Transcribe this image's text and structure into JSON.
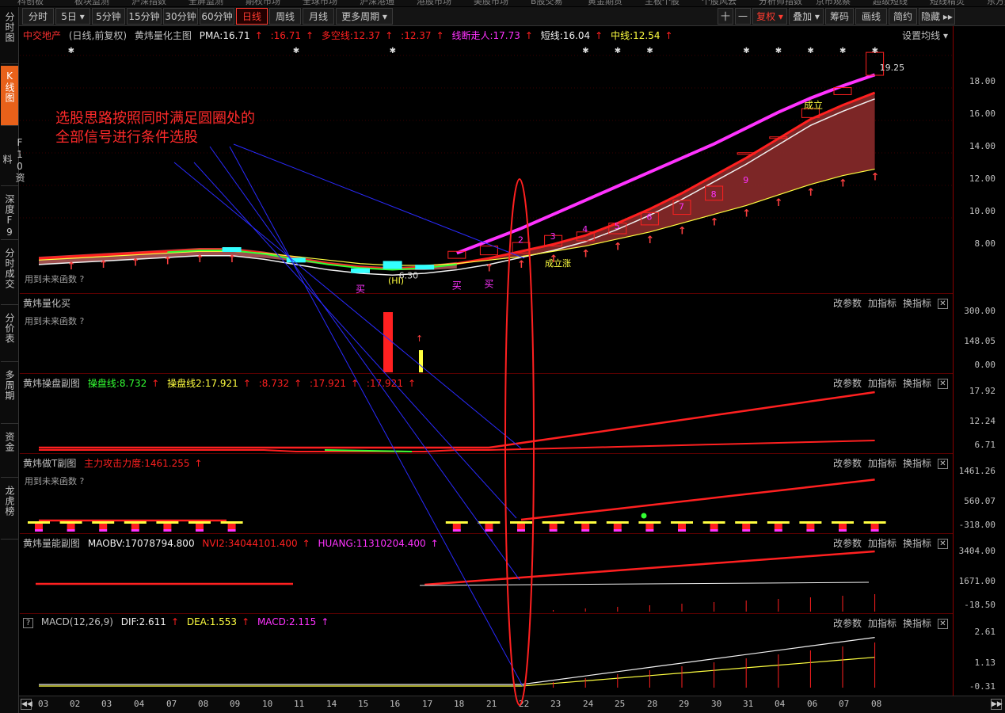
{
  "colors": {
    "red": "#ff2020",
    "magenta": "#ff33ff",
    "yellow": "#ffff40",
    "green": "#33ff33",
    "cyan": "#33ffff",
    "white": "#f0f0f0",
    "orange_tab": "#e8611a",
    "blue_line": "#2a2aff"
  },
  "top_strip": [
    "科创板",
    "板块监测",
    "沪深指数",
    "全屏监测",
    "期权市场",
    "全球市场",
    "沪深港通",
    "港股市场",
    "美股市场",
    "B股交易",
    "黄金期货",
    "主板个股",
    "个股风云",
    "分析师指数",
    "京市观察",
    "超级短线",
    "短线精灵",
    "东方财富"
  ],
  "toolbar": {
    "periods": [
      "分时",
      "5日",
      "5分钟",
      "15分钟",
      "30分钟",
      "60分钟",
      "日线",
      "周线",
      "月线",
      "更多周期"
    ],
    "active_period": "日线",
    "right_tools": [
      "十",
      "一",
      "复权",
      "叠加",
      "筹码",
      "画线",
      "简约",
      "隐藏"
    ]
  },
  "sidebar": [
    {
      "label": "分时图",
      "icon": ""
    },
    {
      "label": "K线图",
      "icon": ""
    },
    {
      "label": "F10资料",
      "icon": ""
    },
    {
      "label": "深度F9",
      "icon": ""
    },
    {
      "label": "分时成交",
      "icon": ""
    },
    {
      "label": "分价表",
      "icon": ""
    },
    {
      "label": "多周期",
      "icon": ""
    },
    {
      "label": "资金",
      "icon": ""
    },
    {
      "label": "龙虎榜",
      "icon": ""
    }
  ],
  "main_panel": {
    "stock_name": "中交地产",
    "sub": "(日线,前复权)",
    "indicator": "黄炜量化主图",
    "pma": "PMA:16.71",
    "pma2": ":16.71",
    "duokong": "多空线:12.37",
    "duokong2": ":12.37",
    "xianduan": "线断走人:17.73",
    "duanxian": "短线:16.04",
    "zhongxian": "中线:12.54",
    "settings": "设置均线",
    "note": "用到未来函数 ?",
    "price_high_label": "19.25",
    "price_low_label": "6.30",
    "buy_marks": [
      "买",
      "买",
      "买"
    ],
    "wave_labels": [
      "2",
      "3",
      "4",
      "5",
      "6",
      "7",
      "8",
      "9"
    ],
    "tags": [
      "成立",
      "成立涨",
      "(HI)"
    ]
  },
  "annotation": {
    "line1": "选股思路按照同时满足圆圈处的",
    "line2": "全部信号进行条件选股"
  },
  "panel_buttons": [
    "改参数",
    "加指标",
    "换指标"
  ],
  "sub1": {
    "title": "黄炜量化买",
    "note": "用到未来函数 ?"
  },
  "sub2": {
    "title": "黄炜操盘副图",
    "l1": "操盘线:8.732",
    "l2": "操盘线2:17.921",
    "v1": ":8.732",
    "v2": ":17.921",
    "v3": ":17.921"
  },
  "sub3": {
    "title": "黄炜做T副图",
    "l1": "主力攻击力度:1461.255",
    "note": "用到未来函数 ?"
  },
  "sub4": {
    "title": "黄炜量能副图",
    "l1": "MAOBV:17078794.800",
    "l2": "NVI2:34044101.400",
    "l3": "HUANG:11310204.400"
  },
  "sub5": {
    "q": "?",
    "title": "MACD(12,26,9)",
    "dif": "DIF:2.611",
    "dea": "DEA:1.553",
    "macd": "MACD:2.115"
  },
  "axis": {
    "main": [
      "18.00",
      "16.00",
      "14.00",
      "12.00",
      "10.00",
      "8.00"
    ],
    "sub1": [
      "300.00",
      "148.05",
      "0.00"
    ],
    "sub2": [
      "17.92",
      "12.24",
      "6.71"
    ],
    "sub3": [
      "1461.26",
      "560.07",
      "-318.00"
    ],
    "sub4": [
      "3404.00",
      "1671.00",
      "-18.50"
    ],
    "sub5": [
      "2.61",
      "1.13",
      "-0.31"
    ]
  },
  "dates": [
    "03",
    "02",
    "03",
    "04",
    "07",
    "08",
    "09",
    "10",
    "11",
    "14",
    "15",
    "16",
    "17",
    "18",
    "21",
    "22",
    "23",
    "24",
    "25",
    "28",
    "29",
    "30",
    "31",
    "04",
    "06",
    "07",
    "08"
  ],
  "chart_data": {
    "type": "line",
    "categories": [
      "03",
      "02",
      "03",
      "04",
      "07",
      "08",
      "09",
      "10",
      "11",
      "14",
      "15",
      "16",
      "17",
      "18",
      "21",
      "22",
      "23",
      "24",
      "25",
      "28",
      "29",
      "30",
      "31",
      "04",
      "06",
      "07",
      "08"
    ],
    "series": [
      {
        "name": "PMA",
        "values": [
          7.3,
          7.4,
          7.5,
          7.6,
          7.7,
          7.8,
          7.8,
          7.6,
          7.3,
          7.0,
          6.8,
          6.7,
          6.8,
          7.0,
          7.3,
          7.7,
          8.1,
          8.6,
          9.3,
          10.1,
          11.0,
          12.0,
          13.0,
          14.1,
          15.2,
          16.0,
          16.71
        ]
      },
      {
        "name": "多空线",
        "values": [
          7.2,
          7.3,
          7.4,
          7.5,
          7.6,
          7.7,
          7.7,
          7.6,
          7.4,
          7.2,
          7.0,
          6.9,
          6.9,
          7.0,
          7.2,
          7.4,
          7.7,
          8.0,
          8.4,
          8.8,
          9.3,
          9.8,
          10.3,
          10.9,
          11.5,
          12.0,
          12.37
        ]
      },
      {
        "name": "线断走人",
        "values": [
          null,
          null,
          null,
          null,
          null,
          null,
          null,
          null,
          null,
          null,
          null,
          null,
          null,
          7.6,
          8.3,
          9.0,
          9.8,
          10.6,
          11.4,
          12.2,
          13.0,
          13.8,
          14.7,
          15.6,
          16.4,
          17.1,
          17.73
        ]
      }
    ],
    "ylim": [
      6,
      19.5
    ]
  }
}
